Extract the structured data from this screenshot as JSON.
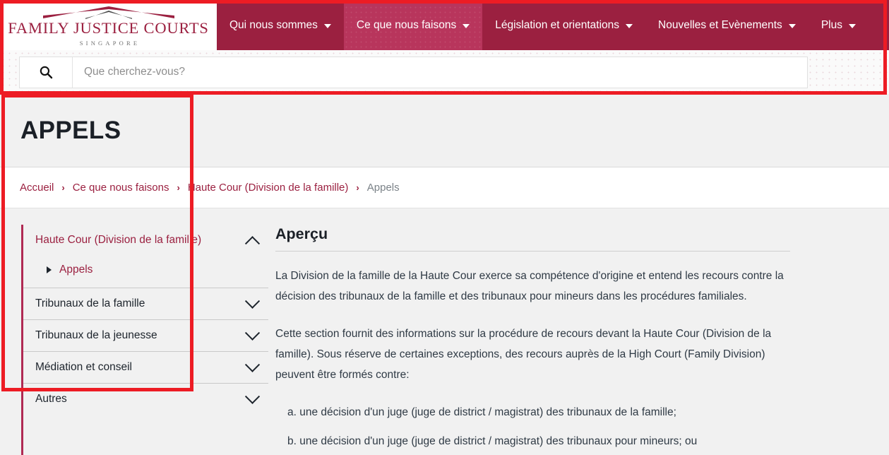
{
  "header": {
    "logo": {
      "name": "FAMILY JUSTICE COURTS",
      "subtitle": "SINGAPORE",
      "roof_icon": "roof-chevron-icon"
    },
    "nav_items": [
      {
        "label": "Qui nous sommes",
        "caret": "chevron-down-icon",
        "active": false
      },
      {
        "label": "Ce que nous faisons",
        "caret": "chevron-down-icon",
        "active": true
      },
      {
        "label": "Législation et orientations",
        "caret": "chevron-down-icon",
        "active": false
      },
      {
        "label": "Nouvelles et Evènements",
        "caret": "chevron-down-icon",
        "active": false
      },
      {
        "label": "Plus",
        "caret": "chevron-down-icon",
        "active": false
      }
    ],
    "bar_color": "#9b2040",
    "active_color": "#b8355c"
  },
  "search": {
    "icon": "search-icon",
    "placeholder": "Que cherchez-vous?",
    "value": ""
  },
  "page": {
    "title": "APPELS"
  },
  "breadcrumb": {
    "separator": "›",
    "items": [
      {
        "label": "Accueil",
        "current": false
      },
      {
        "label": "Ce que nous faisons",
        "current": false
      },
      {
        "label": "Haute Cour (Division de la famille)",
        "current": false
      },
      {
        "label": "Appels",
        "current": true
      }
    ]
  },
  "sidebar": {
    "accent_color": "#b02a53",
    "groups": [
      {
        "label": "Haute Cour (Division de la famille)",
        "expanded": true,
        "chevron": "chevron-up-icon",
        "children": [
          {
            "label": "Appels",
            "marker": "triangle-right-icon",
            "active": true
          }
        ]
      },
      {
        "label": "Tribunaux de la famille",
        "expanded": false,
        "chevron": "chevron-down-icon",
        "children": []
      },
      {
        "label": "Tribunaux de la jeunesse",
        "expanded": false,
        "chevron": "chevron-down-icon",
        "children": []
      },
      {
        "label": "Médiation et conseil",
        "expanded": false,
        "chevron": "chevron-down-icon",
        "children": []
      },
      {
        "label": "Autres",
        "expanded": false,
        "chevron": "chevron-down-icon",
        "children": []
      }
    ]
  },
  "main": {
    "section_title": "Aperçu",
    "paragraphs": [
      "La Division de la famille de la Haute Cour exerce sa compétence d'origine et entend les recours contre la décision des tribunaux de la famille et des tribunaux pour mineurs dans les procédures familiales.",
      "Cette section fournit des informations sur la procédure de recours devant la Haute Cour (Division de la famille). Sous réserve de certaines exceptions, des recours auprès de la High Court (Family Division) peuvent être formés contre:"
    ],
    "list_items": [
      "a. une décision d'un juge (juge de district / magistrat) des tribunaux de la famille;",
      "b. une décision d'un juge (juge de district / magistrat) des tribunaux pour mineurs; ou"
    ]
  },
  "annotations": {
    "color": "#ed1c24",
    "boxes": [
      {
        "name": "header-region-highlight"
      },
      {
        "name": "sidebar-region-highlight"
      }
    ]
  }
}
